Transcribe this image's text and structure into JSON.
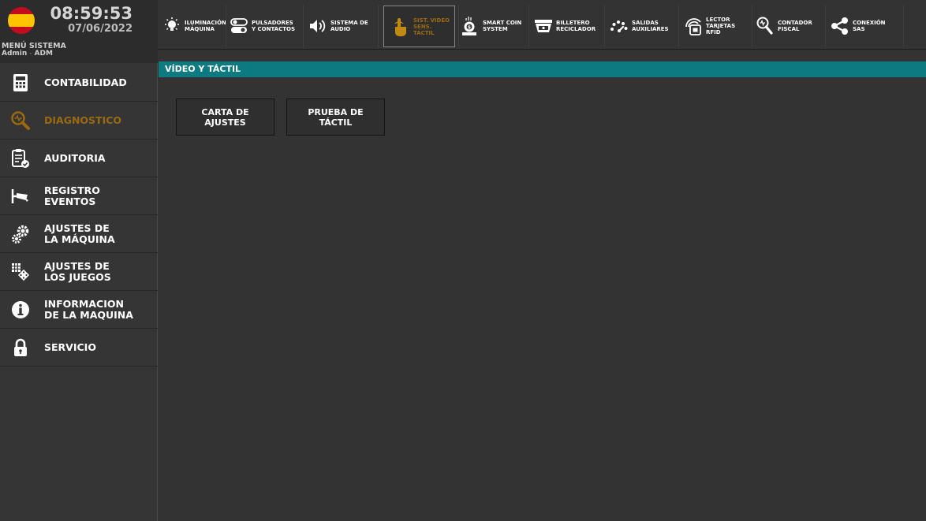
{
  "status": {
    "time": "08:59:53",
    "date": "07/06/2022",
    "menu_title": "MENÚ SISTEMA",
    "user": "Admin",
    "role": "ADM",
    "flag_icon": "spain-flag-icon"
  },
  "sidebar": {
    "items": [
      {
        "label": "CONTABILIDAD",
        "icon": "calculator-icon"
      },
      {
        "label": "DIAGNOSTICO",
        "icon": "diagnostic-magnifier-icon",
        "active": true
      },
      {
        "label": "AUDITORIA",
        "icon": "clipboard-check-icon"
      },
      {
        "label": "REGISTRO\nEVENTOS",
        "icon": "security-camera-icon"
      },
      {
        "label": "AJUSTES DE\nLA MÁQUINA",
        "icon": "gears-icon"
      },
      {
        "label": "AJUSTES DE\nLOS JUEGOS",
        "icon": "game-grid-icon"
      },
      {
        "label": "INFORMACION\nDE LA MAQUINA",
        "icon": "info-icon"
      },
      {
        "label": "SERVICIO",
        "icon": "padlock-icon"
      }
    ]
  },
  "toolbar": {
    "items": [
      {
        "label": "ILUMINACIÓN\nMÁQUINA",
        "icon": "lightbulb-icon"
      },
      {
        "label": "PULSADORES\nY CONTACTOS",
        "icon": "toggle-switch-icon"
      },
      {
        "label": "SISTEMA DE\nAUDIO",
        "icon": "speaker-icon"
      },
      {
        "label": "SIST. VIDEO\nSENS. TÁCTIL",
        "icon": "touch-hand-icon",
        "active": true
      },
      {
        "label": "SMART COIN\nSYSTEM",
        "icon": "coin-hopper-icon"
      },
      {
        "label": "BILLETERO\nRECICLADOR",
        "icon": "bill-recycler-icon"
      },
      {
        "label": "SALIDAS\nAUXILIARES",
        "icon": "auxiliary-outputs-icon"
      },
      {
        "label": "LECTOR\nTARJETAS\nRFID",
        "icon": "rfid-reader-icon"
      },
      {
        "label": "CONTADOR\nFISCAL",
        "icon": "fiscal-counter-icon"
      },
      {
        "label": "CONEXIÓN\nSAS",
        "icon": "share-network-icon"
      }
    ]
  },
  "content": {
    "section_title": "VÍDEO Y TÁCTIL",
    "buttons": [
      {
        "label": "CARTA DE\nAJUSTES"
      },
      {
        "label": "PRUEBA DE\nTÁCTIL"
      }
    ]
  },
  "colors": {
    "section_bar": "#0d7a82",
    "active_text": "#9a6a12",
    "background": "#333333"
  }
}
